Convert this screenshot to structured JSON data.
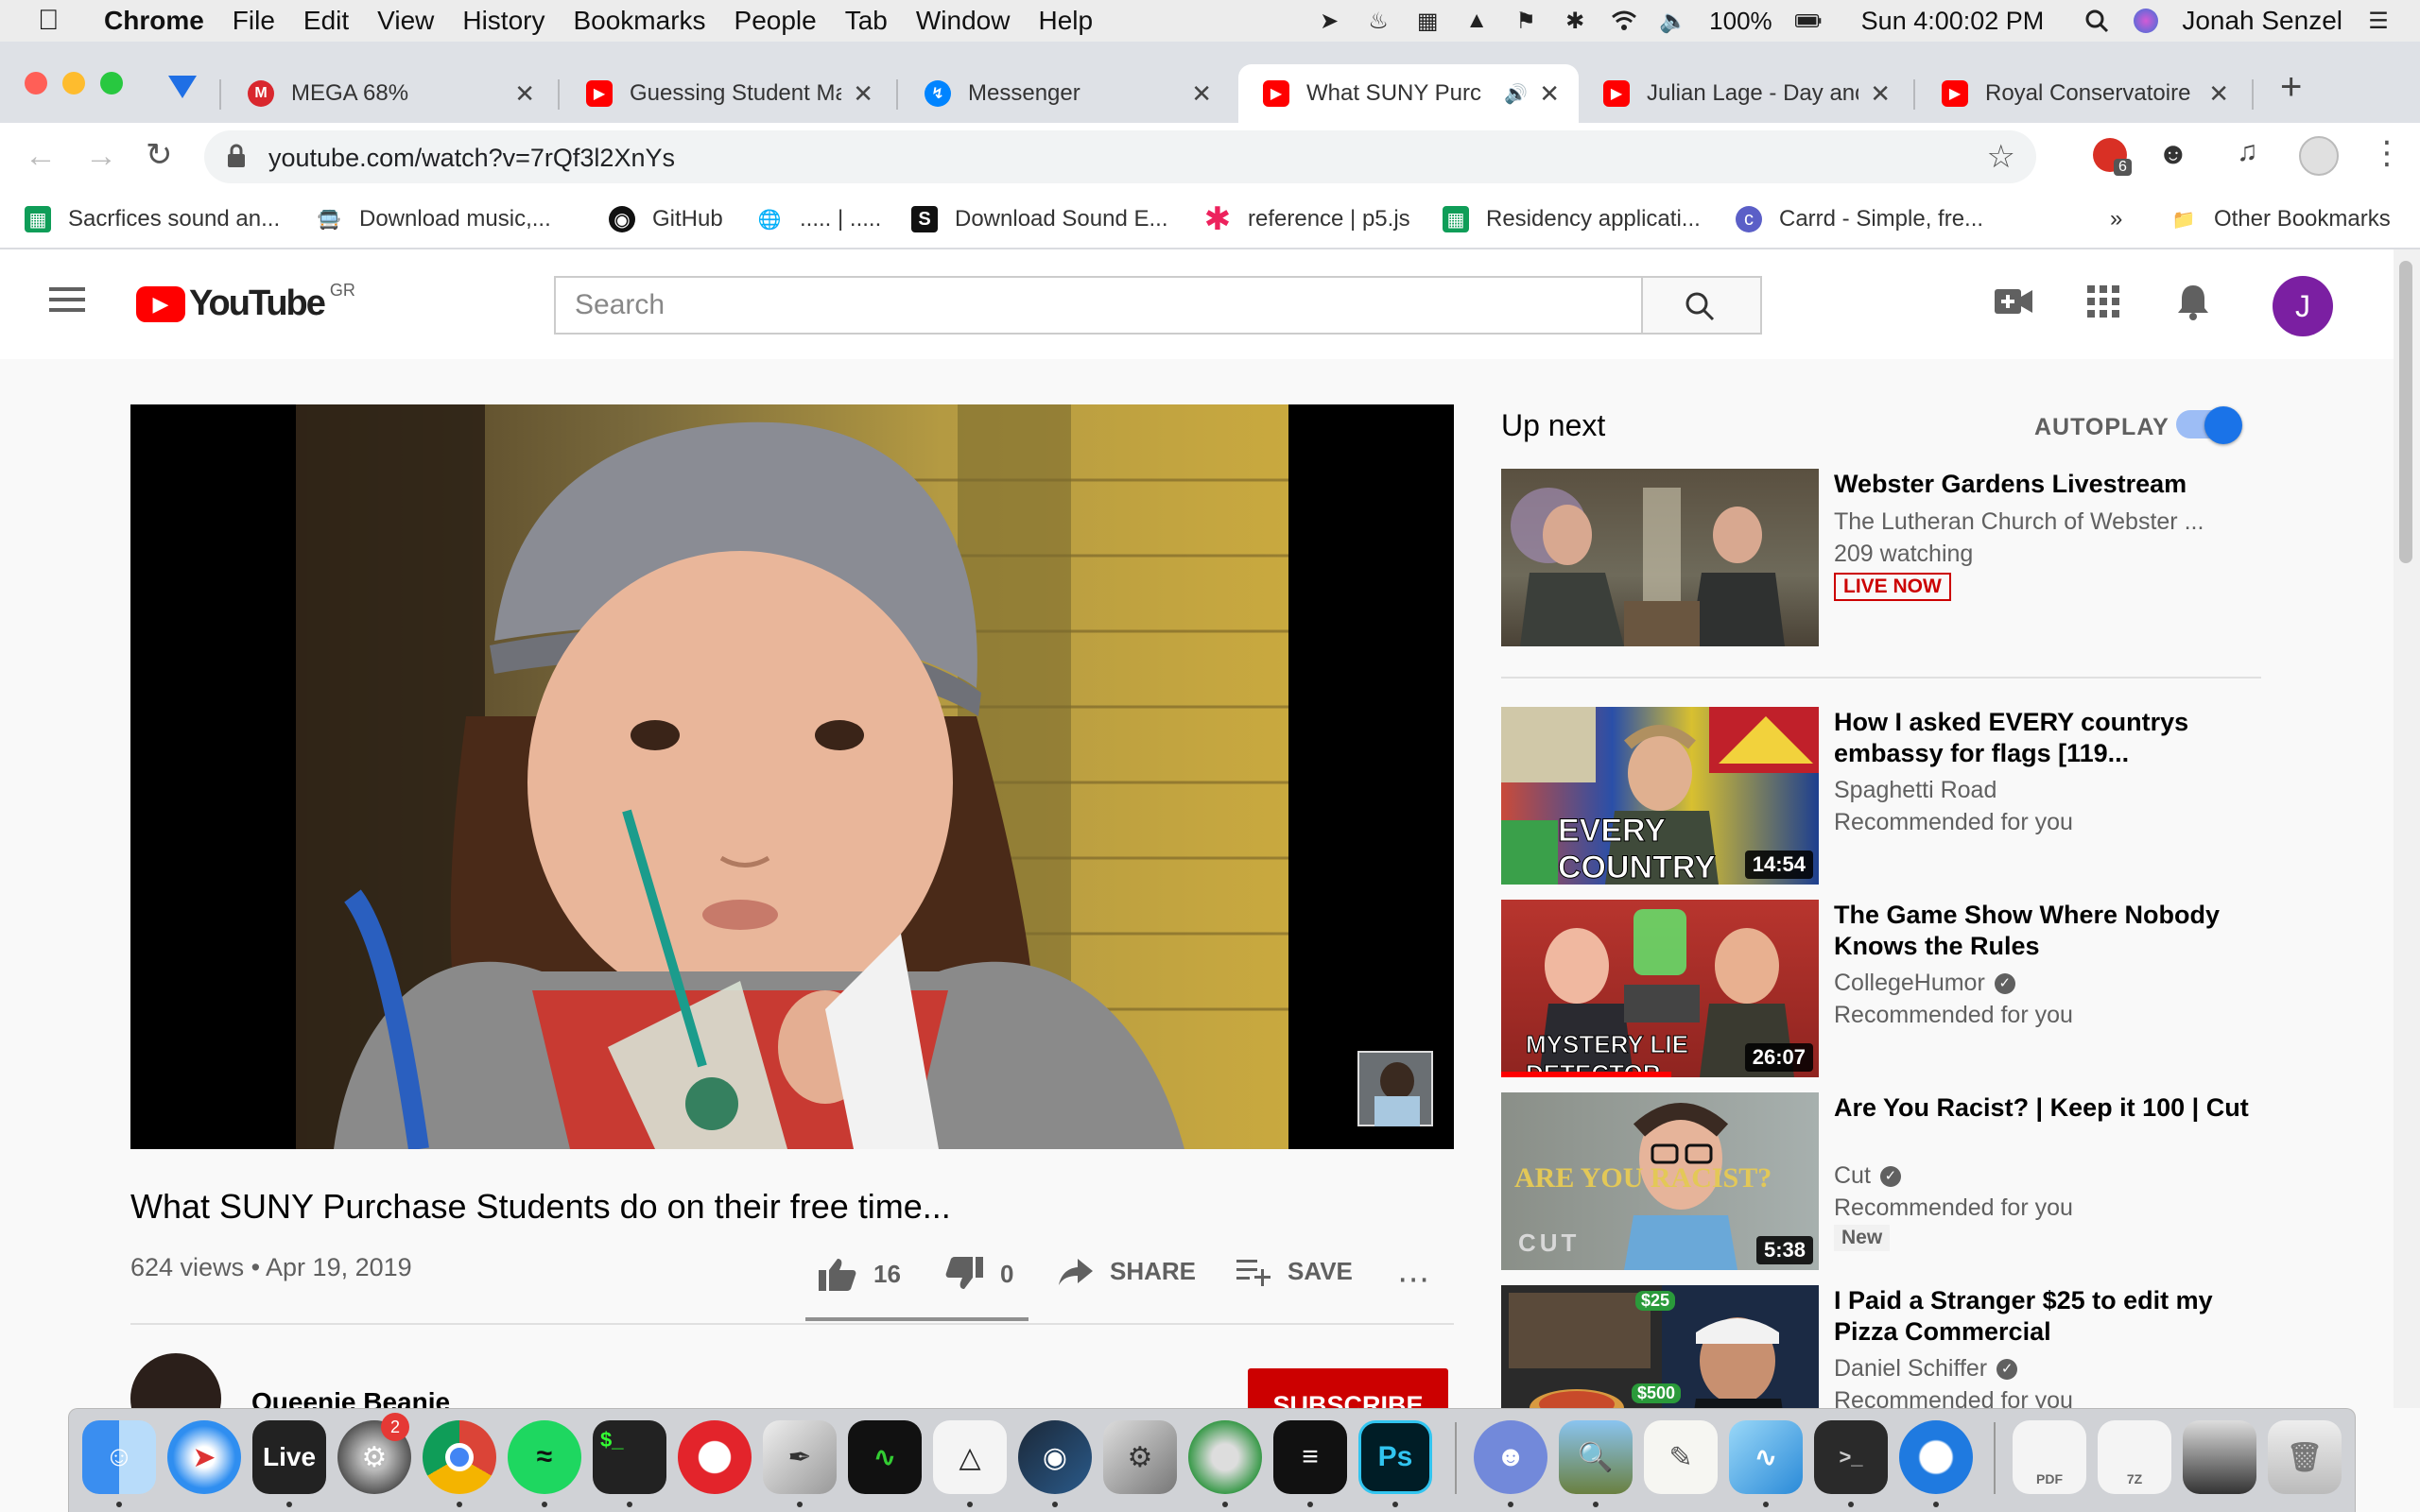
{
  "menubar": {
    "app": "Chrome",
    "items": [
      "File",
      "Edit",
      "View",
      "History",
      "Bookmarks",
      "People",
      "Tab",
      "Window",
      "Help"
    ],
    "battery": "100%",
    "clock": "Sun 4:00:02 PM",
    "user": "Jonah Senzel"
  },
  "tabs": [
    {
      "title": "MEGA 68%",
      "icon": "mega-icon",
      "color": "#d9272e"
    },
    {
      "title": "Guessing Student Ma",
      "icon": "youtube-icon",
      "color": "#ff0000"
    },
    {
      "title": "Messenger",
      "icon": "messenger-icon",
      "color": "#0084ff"
    },
    {
      "title": "What SUNY Purc",
      "icon": "youtube-icon",
      "color": "#ff0000"
    },
    {
      "title": "Julian Lage - Day and",
      "icon": "youtube-icon",
      "color": "#ff0000"
    },
    {
      "title": "Royal Conservatoire o",
      "icon": "youtube-icon",
      "color": "#ff0000"
    }
  ],
  "toolbar": {
    "url": "youtube.com/watch?v=7rQf3l2XnYs",
    "ext_badge": "6"
  },
  "bookmarks": [
    {
      "label": "Sacrfices sound an...",
      "icon": "sheets-icon"
    },
    {
      "label": "Download music,...",
      "icon": "bus-icon"
    },
    {
      "label": "GitHub",
      "icon": "github-icon"
    },
    {
      "label": "..... | .....",
      "icon": "globe-icon"
    },
    {
      "label": "Download Sound E...",
      "icon": "s-icon"
    },
    {
      "label": "reference | p5.js",
      "icon": "asterisk-icon"
    },
    {
      "label": "Residency applicati...",
      "icon": "sheets-icon"
    },
    {
      "label": "Carrd - Simple, fre...",
      "icon": "carrd-icon"
    }
  ],
  "bookmarks_more": "»",
  "bookmarks_other": "Other Bookmarks",
  "youtube": {
    "logo": "YouTube",
    "region": "GR",
    "search_placeholder": "Search",
    "avatar_letter": "J",
    "video": {
      "title": "What SUNY Purchase Students do on their free time...",
      "views_date": "624 views • Apr 19, 2019",
      "likes": "16",
      "dislikes": "0",
      "share": "SHARE",
      "save": "SAVE",
      "channel": "Queenie Beanie",
      "subscribe": "SUBSCRIBE"
    },
    "upnext_label": "Up next",
    "autoplay_label": "AUTOPLAY",
    "autoplay_on": true,
    "recommendations": [
      {
        "title": "Webster Gardens Livestream",
        "channel": "The Lutheran Church of Webster ...",
        "meta": "209 watching",
        "badge": "LIVE NOW",
        "duration": "",
        "verified": false
      },
      {
        "title": "How I asked EVERY countrys embassy for flags [119...",
        "channel": "Spaghetti Road",
        "meta": "Recommended for you",
        "badge": "",
        "duration": "14:54",
        "verified": false,
        "thumb_text": "EVERY COUNTRY"
      },
      {
        "title": "The Game Show Where Nobody Knows the Rules",
        "channel": "CollegeHumor",
        "meta": "Recommended for you",
        "badge": "",
        "duration": "26:07",
        "verified": true,
        "thumb_text": "MYSTERY LIE DETECTOR"
      },
      {
        "title": "Are You Racist? | Keep it 100 | Cut",
        "channel": "Cut",
        "meta": "Recommended for you",
        "badge": "New",
        "duration": "5:38",
        "verified": true,
        "thumb_text": "ARE YOU RACIST?",
        "thumb_text_2": "CUT"
      },
      {
        "title": "I Paid a Stranger $25 to edit my Pizza Commercial",
        "channel": "Daniel Schiffer",
        "meta": "Recommended for you",
        "badge": "",
        "duration": "",
        "verified": true,
        "thumb_text": "$25",
        "thumb_text_2": "$500"
      }
    ]
  },
  "dock": {
    "badge_settings": "2",
    "apps": [
      "Finder",
      "Safari",
      "Live",
      "System Preferences",
      "Chrome",
      "Spotify",
      "Terminal",
      "Opera",
      "Pen",
      "Activity Monitor",
      "Unity",
      "Steam",
      "Automator",
      "Reaper",
      "Text",
      "Photoshop",
      "Discord",
      "Preview",
      "TextEdit",
      "Dolphin",
      "Terminal",
      "QuickTime",
      "PDF",
      "Archive",
      "Photo",
      "Trash"
    ],
    "labels": {
      "live": "Live",
      "ps": "Ps",
      "term": "$_",
      "pdf": "PDF",
      "sevenz": "7Z"
    }
  }
}
